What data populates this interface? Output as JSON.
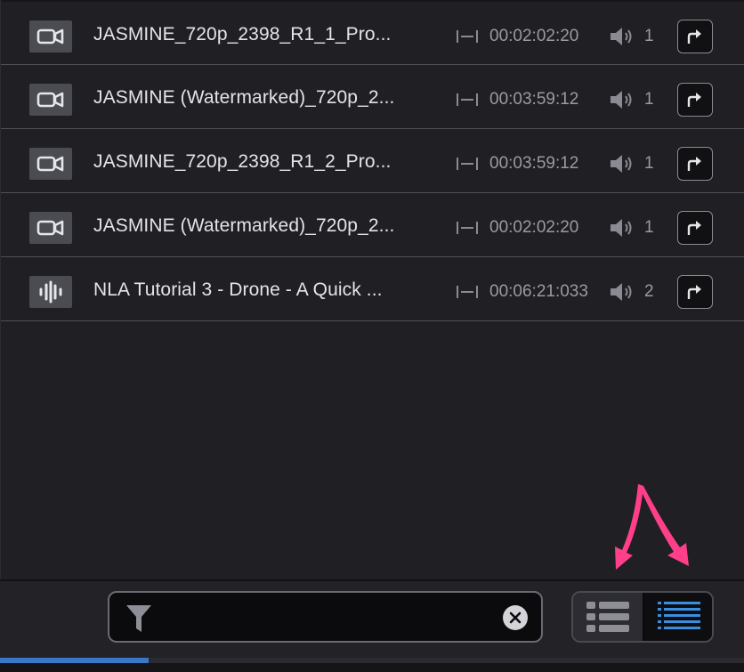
{
  "media_list": {
    "rows": [
      {
        "type": "video",
        "type_icon": "video-camera-icon",
        "name": "JASMINE_720p_2398_R1_1_Pro...",
        "duration": "00:02:02:20",
        "channels": "1"
      },
      {
        "type": "video",
        "type_icon": "video-camera-icon",
        "name": "JASMINE (Watermarked)_720p_2...",
        "duration": "00:03:59:12",
        "channels": "1"
      },
      {
        "type": "video",
        "type_icon": "video-camera-icon",
        "name": "JASMINE_720p_2398_R1_2_Pro...",
        "duration": "00:03:59:12",
        "channels": "1"
      },
      {
        "type": "video",
        "type_icon": "video-camera-icon",
        "name": "JASMINE (Watermarked)_720p_2...",
        "duration": "00:02:02:20",
        "channels": "1"
      },
      {
        "type": "audio",
        "type_icon": "audio-waveform-icon",
        "name": "NLA Tutorial 3 - Drone - A Quick ...",
        "duration": "00:06:21:033",
        "channels": "2"
      }
    ]
  },
  "search": {
    "value": "",
    "placeholder": ""
  },
  "view_toggle": {
    "left_icon": "list-view-icon",
    "right_icon": "detailed-list-view-icon",
    "active": "right"
  },
  "progress": {
    "fraction": 0.2
  },
  "colors": {
    "accent_blue": "#3a78c8",
    "annotation_pink": "#ff3f8a"
  }
}
